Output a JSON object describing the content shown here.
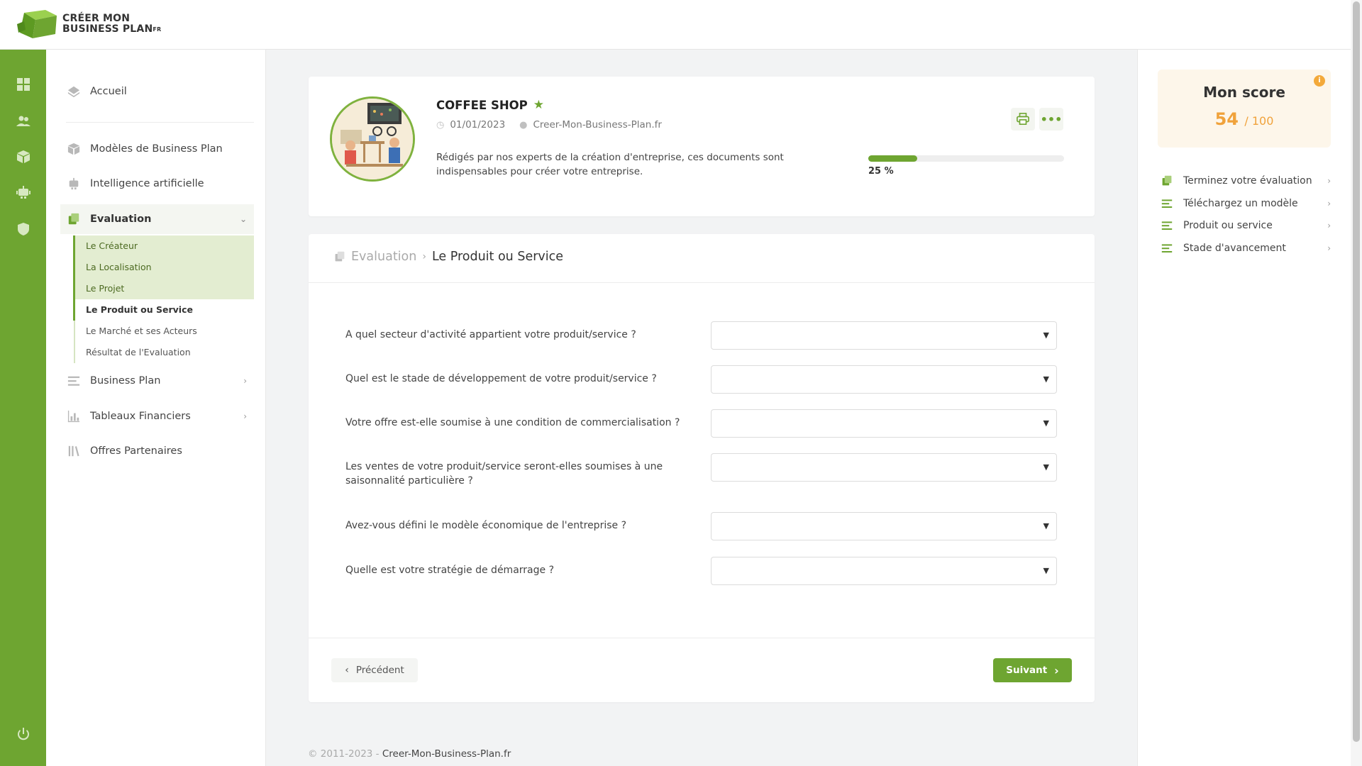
{
  "logo": {
    "line1": "CRÉER MON",
    "line2": "BUSINESS PLAN",
    "suffix": "FR"
  },
  "sidebar": {
    "home": "Accueil",
    "models": "Modèles de Business Plan",
    "ai": "Intelligence artificielle",
    "evaluation": "Evaluation",
    "sub_items": [
      "Le Créateur",
      "La Localisation",
      "Le Projet",
      "Le Produit ou Service",
      "Le Marché et ses Acteurs",
      "Résultat de l'Evaluation"
    ],
    "business_plan": "Business Plan",
    "financial": "Tableaux Financiers",
    "partners": "Offres Partenaires"
  },
  "project": {
    "title": "COFFEE SHOP",
    "date": "01/01/2023",
    "author": "Creer-Mon-Business-Plan.fr",
    "description": "Rédigés par nos experts de la création d'entreprise, ces documents sont indispensables pour créer votre entreprise.",
    "progress_label": "25 %",
    "progress_value": 25
  },
  "breadcrumb": {
    "parent": "Evaluation",
    "current": "Le Produit ou Service"
  },
  "questions": [
    "A quel secteur d'activité appartient votre produit/service ?",
    "Quel est le stade de développement de votre produit/service ?",
    "Votre offre est-elle soumise à une condition de commercialisation ?",
    "Les ventes de votre produit/service seront-elles soumises à une saisonnalité particulière ?",
    "Avez-vous défini le modèle économique de l'entreprise ?",
    "Quelle est votre stratégie de démarrage ?"
  ],
  "buttons": {
    "prev": "Précédent",
    "next": "Suivant"
  },
  "footer": {
    "copyright": "© 2011-2023 -",
    "brand": "Creer-Mon-Business-Plan.fr"
  },
  "score": {
    "title": "Mon score",
    "value": "54",
    "max": "/ 100",
    "info": "i"
  },
  "tasks": [
    "Terminez votre évaluation",
    "Téléchargez un modèle",
    "Produit ou service",
    "Stade d'avancement"
  ],
  "colors": {
    "brand_green": "#6ea531",
    "score_orange": "#f0a23b"
  }
}
